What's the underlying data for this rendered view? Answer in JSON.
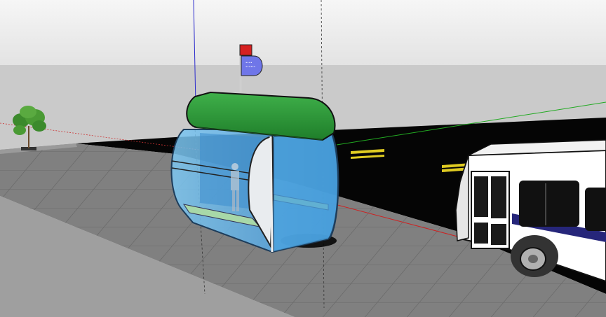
{
  "scene": {
    "type": "3d-model-viewport",
    "subject": "bus-stop-shelter",
    "sign_text_line1": "•••• ",
    "sign_text_line2": "•••••• ",
    "colors": {
      "sky_top": "#f4f4f4",
      "sky_horizon": "#dcdcdc",
      "ground": "#c9c9c9",
      "road": "#050505",
      "sidewalk": "#7f7f7f",
      "curb_face": "#b4b4b4",
      "shelter_glass": "#5fb2e8",
      "shelter_roof": "#2f9b3a",
      "flag": "#d62020",
      "sign": "#6f76e8",
      "bus_body": "#ffffff",
      "bus_stripe": "#26267a",
      "lane_marking": "#e6d01e"
    },
    "axes": {
      "red": "#cc2222",
      "green": "#22aa22",
      "blue": "#2222cc"
    }
  }
}
